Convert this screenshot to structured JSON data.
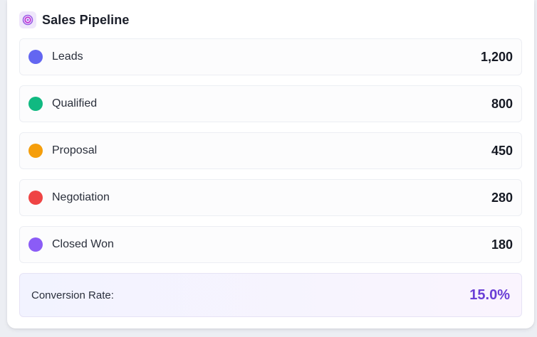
{
  "header": {
    "title": "Sales Pipeline",
    "icon": "target-icon",
    "icon_color": "#9b5de5"
  },
  "stages": [
    {
      "label": "Leads",
      "value": "1,200",
      "color": "#6366f1"
    },
    {
      "label": "Qualified",
      "value": "800",
      "color": "#10b981"
    },
    {
      "label": "Proposal",
      "value": "450",
      "color": "#f59e0b"
    },
    {
      "label": "Negotiation",
      "value": "280",
      "color": "#ef4444"
    },
    {
      "label": "Closed Won",
      "value": "180",
      "color": "#8b5cf6"
    }
  ],
  "conversion": {
    "label": "Conversion Rate:",
    "value": "15.0%",
    "color": "#6a3fd6"
  }
}
